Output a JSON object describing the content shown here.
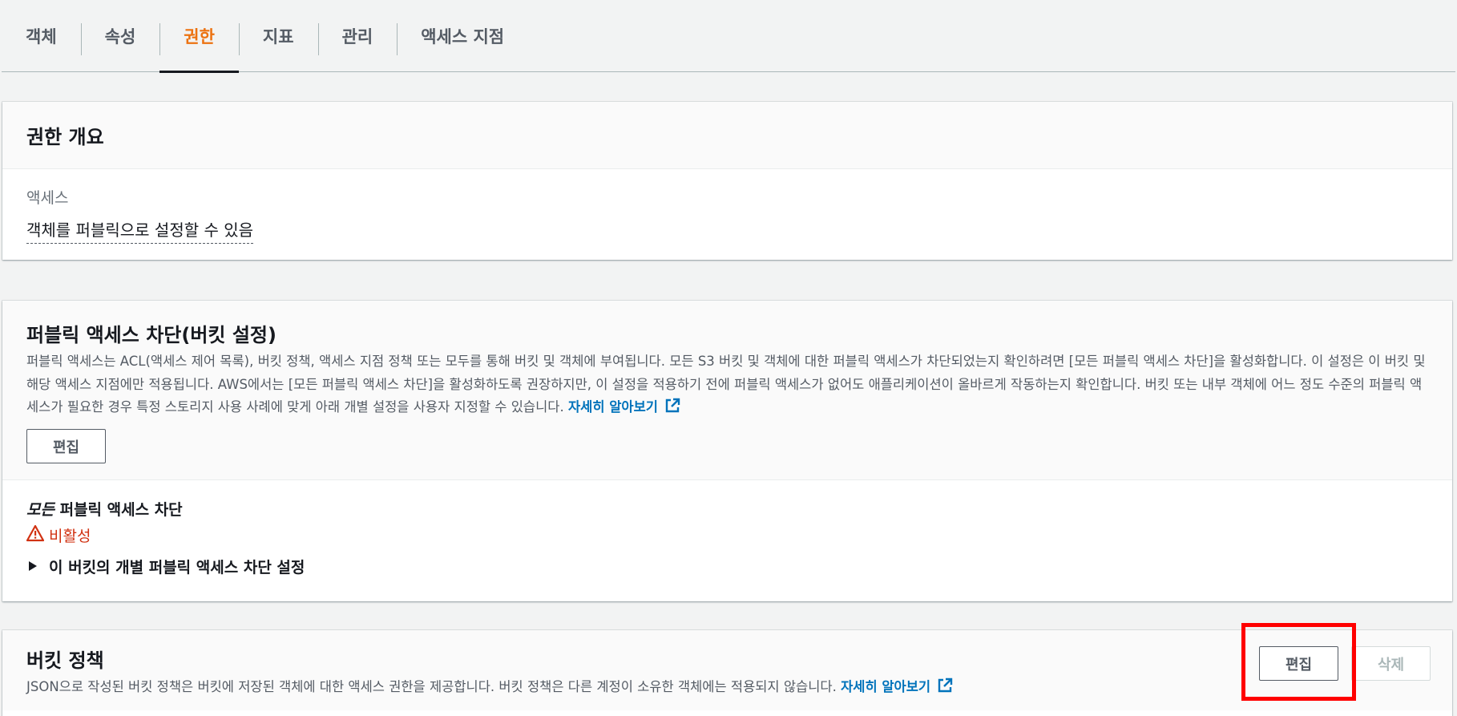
{
  "tabs": [
    {
      "label": "객체"
    },
    {
      "label": "속성"
    },
    {
      "label": "권한"
    },
    {
      "label": "지표"
    },
    {
      "label": "관리"
    },
    {
      "label": "액세스 지점"
    }
  ],
  "active_tab": "권한",
  "overview": {
    "title": "권한 개요",
    "access_label": "액세스",
    "access_value": "객체를 퍼블릭으로 설정할 수 있음"
  },
  "block_public_access": {
    "title": "퍼블릭 액세스 차단(버킷 설정)",
    "description": "퍼블릭 액세스는 ACL(액세스 제어 목록), 버킷 정책, 액세스 지점 정책 또는 모두를 통해 버킷 및 객체에 부여됩니다. 모든 S3 버킷 및 객체에 대한 퍼블릭 액세스가 차단되었는지 확인하려면 [모든 퍼블릭 액세스 차단]을 활성화합니다. 이 설정은 이 버킷 및 해당 액세스 지점에만 적용됩니다. AWS에서는 [모든 퍼블릭 액세스 차단]을 활성화하도록 권장하지만, 이 설정을 적용하기 전에 퍼블릭 액세스가 없어도 애플리케이션이 올바르게 작동하는지 확인합니다. 버킷 또는 내부 객체에 어느 정도 수준의 퍼블릭 액세스가 필요한 경우 특정 스토리지 사용 사례에 맞게 아래 개별 설정을 사용자 지정할 수 있습니다.",
    "learn_more": "자세히 알아보기",
    "edit_label": "편집",
    "setting_title_em": "모든",
    "setting_title_rest": " 퍼블릭 액세스 차단",
    "status": "비활성",
    "expander_label": "이 버킷의 개별 퍼블릭 액세스 차단 설정"
  },
  "bucket_policy": {
    "title": "버킷 정책",
    "description": "JSON으로 작성된 버킷 정책은 버킷에 저장된 객체에 대한 액세스 권한을 제공합니다. 버킷 정책은 다른 계정이 소유한 객체에는 적용되지 않습니다.",
    "learn_more": "자세히 알아보기",
    "edit_label": "편집",
    "delete_label": "삭제"
  },
  "colors": {
    "accent": "#ec7211",
    "link": "#0073bb",
    "warning": "#d13212",
    "highlight": "#ff0000"
  },
  "icons": [
    "external-link-icon",
    "warning-icon",
    "caret-right-icon"
  ]
}
